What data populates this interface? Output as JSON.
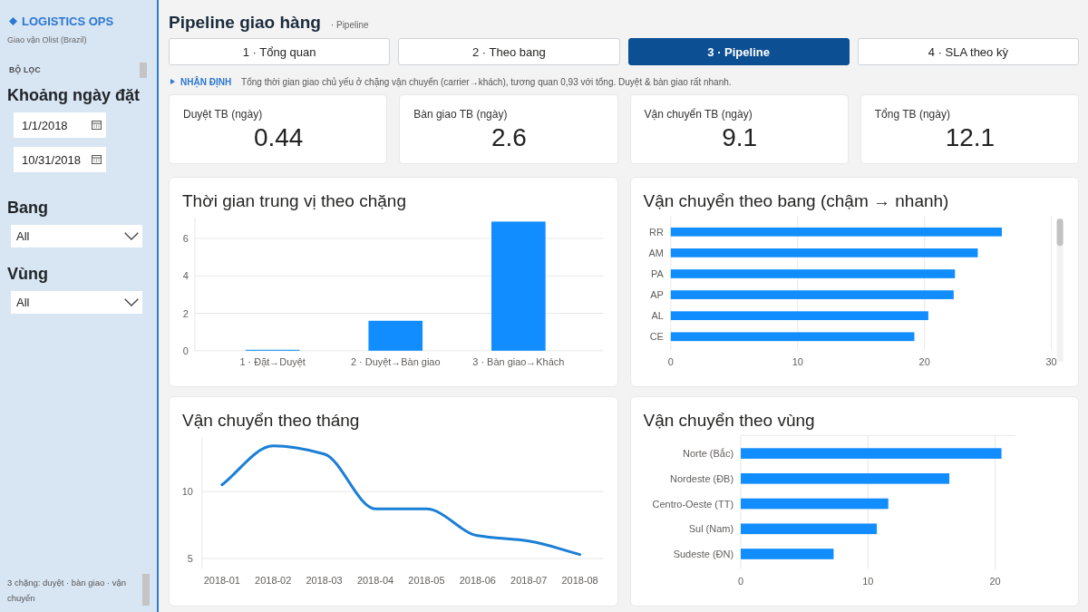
{
  "sidebar": {
    "brand": "LOGISTICS OPS",
    "subtitle": "Giao vận Olist (Brazil)",
    "section_label": "BỘ LỌC",
    "filters": [
      {
        "kind": "date_range",
        "label": "Khoảng ngày đặt",
        "values": [
          "1/1/2018",
          "10/31/2018"
        ]
      },
      {
        "kind": "dropdown",
        "label": "Bang",
        "value": "All"
      },
      {
        "kind": "dropdown",
        "label": "Vùng",
        "value": "All"
      }
    ],
    "footer": "3 chặng: duyệt · bàn giao · vận chuyển"
  },
  "header": {
    "title": "Pipeline giao hàng",
    "breadcrumb": "· Pipeline"
  },
  "tabs": [
    {
      "label": "1 · Tổng quan",
      "selected": false
    },
    {
      "label": "2 · Theo bang",
      "selected": false
    },
    {
      "label": "3 · Pipeline",
      "selected": true
    },
    {
      "label": "4 · SLA theo kỳ",
      "selected": false
    }
  ],
  "insight": {
    "label": "NHẬN ĐỊNH",
    "text": "Tổng thời gian giao chủ yếu ở chặng vận chuyển (carrier→khách), tương quan 0,93 với tổng. Duyệt & bàn giao rất nhanh."
  },
  "kpis": [
    {
      "label": "Duyệt TB (ngày)",
      "value": "0.44"
    },
    {
      "label": "Bàn giao TB (ngày)",
      "value": "2.6"
    },
    {
      "label": "Vận chuyển TB (ngày)",
      "value": "9.1"
    },
    {
      "label": "Tổng TB (ngày)",
      "value": "12.1"
    }
  ],
  "charts": [
    {
      "scrollable": false,
      "chart_data": {
        "type": "bar",
        "orientation": "vertical",
        "title": "Thời gian trung vị theo chặng",
        "categories": [
          "1 · Đặt→Duyệt",
          "2 · Duyệt→Bàn giao",
          "3 · Bàn giao→Khách"
        ],
        "values": [
          0.05,
          1.6,
          6.9
        ],
        "ylim": [
          0,
          7.1
        ],
        "yticks": [
          0,
          2,
          4,
          6
        ],
        "grid": true
      }
    },
    {
      "scrollable": true,
      "chart_data": {
        "type": "bar",
        "orientation": "horizontal",
        "title": "Vận chuyển theo bang (chậm → nhanh)",
        "categories": [
          "RR",
          "AM",
          "PA",
          "AP",
          "AL",
          "CE"
        ],
        "values": [
          26.1,
          24.2,
          22.4,
          22.3,
          20.3,
          19.2
        ],
        "xlim": [
          0,
          30
        ],
        "xticks": [
          0,
          10,
          20,
          30
        ],
        "grid": true
      }
    },
    {
      "scrollable": false,
      "chart_data": {
        "type": "line",
        "title": "Vận chuyển theo tháng",
        "x": [
          "2018-01",
          "2018-02",
          "2018-03",
          "2018-04",
          "2018-05",
          "2018-06",
          "2018-07",
          "2018-08"
        ],
        "values": [
          10.5,
          13.4,
          12.8,
          8.7,
          8.7,
          6.7,
          6.3,
          5.3
        ],
        "ylim": [
          4.2,
          14.05
        ],
        "yticks": [
          5,
          10
        ],
        "grid": true
      }
    },
    {
      "scrollable": false,
      "chart_data": {
        "type": "bar",
        "orientation": "horizontal",
        "title": "Vận chuyển theo vùng",
        "categories": [
          "Norte (Bắc)",
          "Nordeste (ĐB)",
          "Centro-Oeste (TT)",
          "Sul (Nam)",
          "Sudeste (ĐN)"
        ],
        "values": [
          20.5,
          16.4,
          11.6,
          10.7,
          7.3
        ],
        "xlim": [
          0,
          21.6
        ],
        "xticks": [
          0,
          10,
          20
        ],
        "grid": true
      }
    }
  ]
}
